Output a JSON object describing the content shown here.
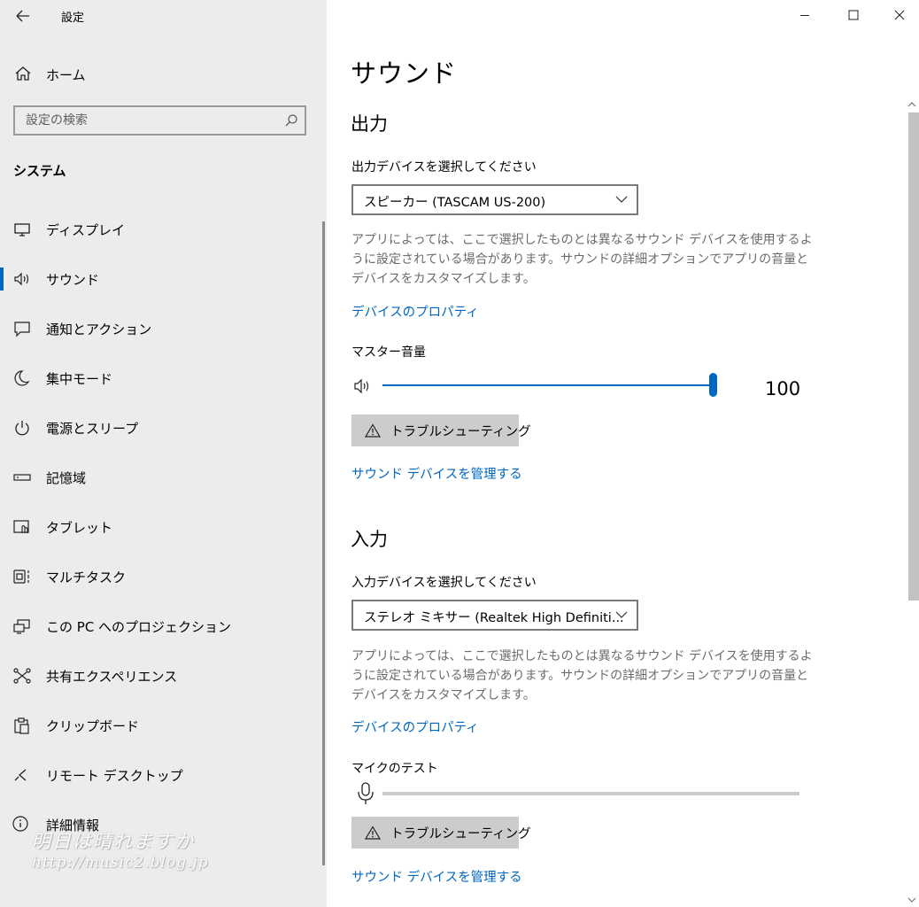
{
  "window": {
    "title": "設定",
    "back_icon": "back-arrow-icon",
    "controls": [
      "minimize-icon",
      "maximize-icon",
      "close-icon"
    ]
  },
  "sidebar": {
    "home_label": "ホーム",
    "search_placeholder": "設定の検索",
    "section_header": "システム",
    "items": [
      {
        "label": "ディスプレイ",
        "icon": "display-icon"
      },
      {
        "label": "サウンド",
        "icon": "speaker-icon",
        "selected": true
      },
      {
        "label": "通知とアクション",
        "icon": "notification-icon"
      },
      {
        "label": "集中モード",
        "icon": "moon-icon"
      },
      {
        "label": "電源とスリープ",
        "icon": "power-icon"
      },
      {
        "label": "記憶域",
        "icon": "storage-icon"
      },
      {
        "label": "タブレット",
        "icon": "tablet-icon"
      },
      {
        "label": "マルチタスク",
        "icon": "multitask-icon"
      },
      {
        "label": "この PC へのプロジェクション",
        "icon": "projection-icon"
      },
      {
        "label": "共有エクスペリエンス",
        "icon": "shared-experience-icon"
      },
      {
        "label": "クリップボード",
        "icon": "clipboard-icon"
      },
      {
        "label": "リモート デスクトップ",
        "icon": "remote-desktop-icon"
      },
      {
        "label": "詳細情報",
        "icon": "info-icon"
      }
    ],
    "watermark": {
      "line1": "明日は晴れますか",
      "line2": "http://music2.blog.jp"
    }
  },
  "main": {
    "title": "サウンド",
    "output": {
      "heading": "出力",
      "device_label": "出力デバイスを選択してください",
      "device_value": "スピーカー (TASCAM US-200)",
      "description": "アプリによっては、ここで選択したものとは異なるサウンド デバイスを使用するように設定されている場合があります。サウンドの詳細オプションでアプリの音量とデバイスをカスタマイズします。",
      "properties_link": "デバイスのプロパティ",
      "volume_label": "マスター音量",
      "volume_value": "100",
      "volume_level": 1.0,
      "troubleshoot_label": "トラブルシューティング",
      "manage_link": "サウンド デバイスを管理する"
    },
    "input": {
      "heading": "入力",
      "device_label": "入力デバイスを選択してください",
      "device_value": "ステレオ ミキサー (Realtek High Definiti...",
      "description": "アプリによっては、ここで選択したものとは異なるサウンド デバイスを使用するように設定されている場合があります。サウンドの詳細オプションでアプリの音量とデバイスをカスタマイズします。",
      "properties_link": "デバイスのプロパティ",
      "mic_test_label": "マイクのテスト",
      "mic_level": 0.0,
      "troubleshoot_label": "トラブルシューティング",
      "manage_link": "サウンド デバイスを管理する"
    }
  },
  "colors": {
    "sidebar_bg": "#ececec",
    "accent": "#0067c0",
    "button_bg": "#cccccc",
    "secondary_text": "#6b6b6b"
  }
}
